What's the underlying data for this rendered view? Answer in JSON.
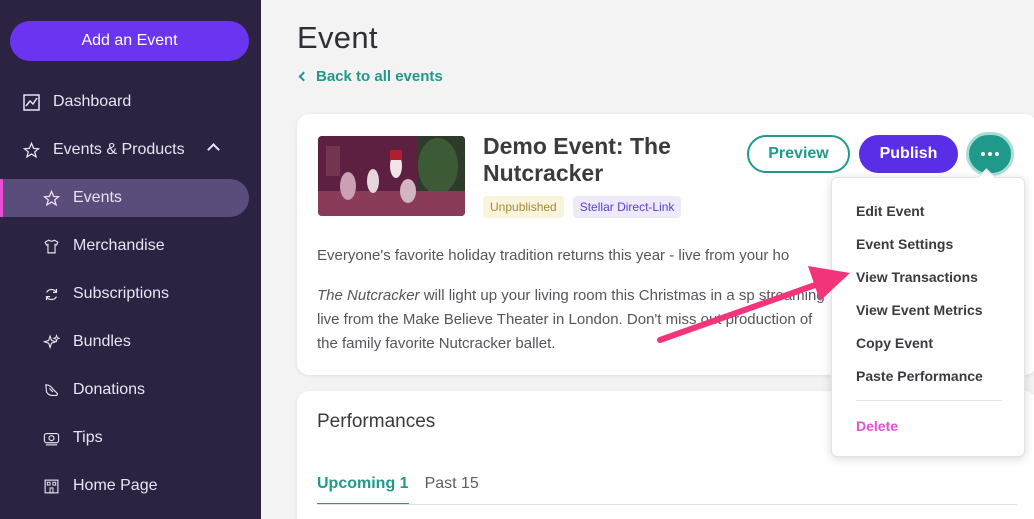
{
  "sidebar": {
    "add_button": "Add an Event",
    "items": [
      {
        "label": "Dashboard",
        "icon": "chart-icon"
      },
      {
        "label": "Events & Products",
        "icon": "star-icon"
      },
      {
        "label": "Events",
        "icon": "star-icon"
      },
      {
        "label": "Merchandise",
        "icon": "tshirt-icon"
      },
      {
        "label": "Subscriptions",
        "icon": "refresh-icon"
      },
      {
        "label": "Bundles",
        "icon": "sparkle-icon"
      },
      {
        "label": "Donations",
        "icon": "donation-icon"
      },
      {
        "label": "Tips",
        "icon": "tips-icon"
      },
      {
        "label": "Home Page",
        "icon": "building-icon"
      }
    ]
  },
  "main": {
    "title": "Event",
    "back_link": "Back to all events",
    "event": {
      "title": "Demo Event: The Nutcracker",
      "badge_status": "Unpublished",
      "badge_link": "Stellar Direct-Link",
      "preview_label": "Preview",
      "publish_label": "Publish",
      "desc_p1": "Everyone's favorite holiday tradition returns this year - live from your ho",
      "desc_p2_em": "The Nutcracker",
      "desc_p2_rest": " will light up your living room this Christmas in a sp streaming live from the Make Believe Theater in London. Don't miss out production of the family favorite Nutcracker ballet."
    },
    "performances": {
      "title": "Performances",
      "tab_upcoming": "Upcoming 1",
      "tab_past": "Past 15"
    }
  },
  "menu": {
    "items": [
      "Edit Event",
      "Event Settings",
      "View Transactions",
      "View Event Metrics",
      "Copy Event",
      "Paste Performance"
    ],
    "delete": "Delete"
  },
  "colors": {
    "sidebar_bg": "#2b2341",
    "accent_purple": "#5a2ee6",
    "accent_teal": "#1f9a8a",
    "accent_pink": "#e94fd0",
    "arrow": "#f2357b"
  }
}
